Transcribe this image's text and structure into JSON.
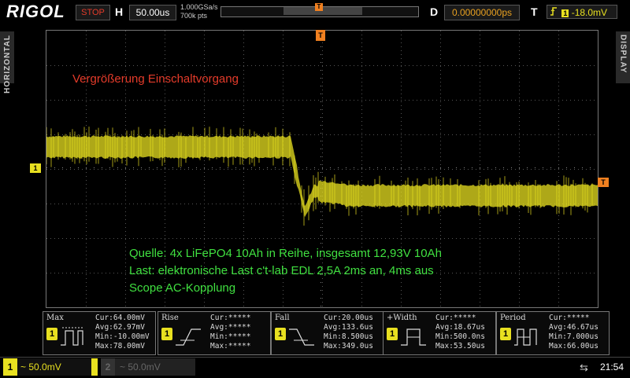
{
  "header": {
    "brand": "RIGOL",
    "run_state": "STOP",
    "h_label": "H",
    "timebase": "50.00us",
    "sample_rate": "1.000GSa/s",
    "mem_depth": "700k pts",
    "mem_marker": "T",
    "d_label": "D",
    "delay": "0.00000000ps",
    "t_label": "T",
    "trigger_icon": "rising-edge-icon",
    "trigger_level": "-18.0mV"
  },
  "side": {
    "left_tab": "HORIZONTAL",
    "right_tab": "DISPLAY"
  },
  "markers": {
    "channel": "1",
    "trigger_level": "T",
    "trigger_position": "T"
  },
  "colors": {
    "ch1": "#e8e020",
    "trigger": "#f08020",
    "stop": "#e43b2a",
    "annotation_red": "#e43b2a",
    "annotation_green": "#40e040"
  },
  "annotations": {
    "title": "Vergrößerung Einschaltvorgang",
    "line1": "Quelle: 4x LiFePO4 10Ah in Reihe, insgesamt 12,93V 10Ah",
    "line2": "Last: elektronische Last c't-lab EDL  2,5A 2ms an, 4ms aus",
    "line3": "Scope AC-Kopplung"
  },
  "measurements": [
    {
      "name": "Max",
      "icon": "max-pulse-icon",
      "ch": "1",
      "cur": "Cur:64.00mV",
      "avg": "Avg:62.97mV",
      "min": "Min:-10.00mV",
      "max": "Max:78.00mV"
    },
    {
      "name": "Rise",
      "icon": "rise-edge-icon",
      "ch": "1",
      "cur": "Cur:*****",
      "avg": "Avg:*****",
      "min": "Min:*****",
      "max": "Max:*****"
    },
    {
      "name": "Fall",
      "icon": "fall-edge-icon",
      "ch": "1",
      "cur": "Cur:20.00us",
      "avg": "Avg:133.6us",
      "min": "Min:8.500us",
      "max": "Max:349.0us"
    },
    {
      "name": "+Width",
      "icon": "positive-width-icon",
      "ch": "1",
      "cur": "Cur:*****",
      "avg": "Avg:18.67us",
      "min": "Min:500.0ns",
      "max": "Max:53.50us"
    },
    {
      "name": "Period",
      "icon": "period-icon",
      "ch": "1",
      "cur": "Cur:*****",
      "avg": "Avg:46.67us",
      "min": "Min:7.000us",
      "max": "Max:66.00us"
    }
  ],
  "footer": {
    "ch1_num": "1",
    "ch1_scale": "~  50.0mV",
    "ch2_num": "2",
    "ch2_scale": "~  50.0mV",
    "usb_icon": "usb-icon",
    "time": "21:54"
  }
}
